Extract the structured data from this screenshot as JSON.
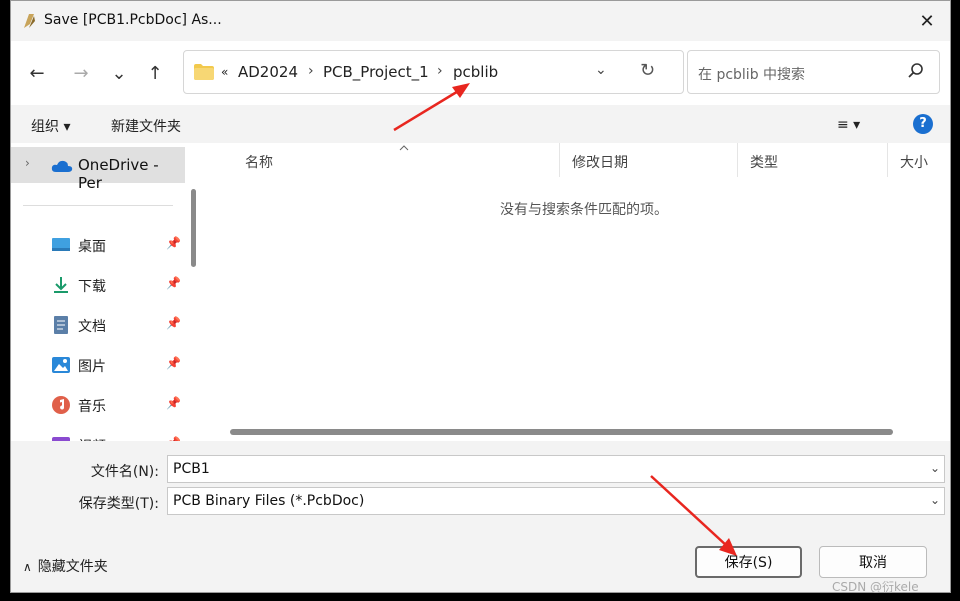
{
  "window": {
    "title": "Save [PCB1.PcbDoc] As..."
  },
  "nav": {
    "back": "←",
    "forward": "→",
    "recent": "⌄",
    "up": "↑",
    "breadcrumb": [
      "«",
      "AD2024",
      "PCB_Project_1",
      "pcblib"
    ],
    "separators": [
      "›",
      "›"
    ],
    "dropdown": "⌄",
    "refresh": "↻",
    "search_placeholder": "在 pcblib 中搜索"
  },
  "toolbar": {
    "organize": "组织 ▾",
    "new_folder": "新建文件夹",
    "view": "≡ ▾",
    "help": "?"
  },
  "sidebar": {
    "onedrive": "OneDrive - Per",
    "items": [
      {
        "label": "桌面",
        "icon": "desktop-icon"
      },
      {
        "label": "下载",
        "icon": "download-icon"
      },
      {
        "label": "文档",
        "icon": "document-icon"
      },
      {
        "label": "图片",
        "icon": "picture-icon"
      },
      {
        "label": "音乐",
        "icon": "music-icon"
      },
      {
        "label": "视频",
        "icon": "video-icon"
      }
    ],
    "pin": "📌"
  },
  "list": {
    "columns": [
      "名称",
      "修改日期",
      "类型",
      "大小"
    ],
    "empty_message": "没有与搜索条件匹配的项。"
  },
  "form": {
    "filename_label": "文件名(N):",
    "filename_value": "PCB1",
    "filetype_label": "保存类型(T):",
    "filetype_value": "PCB Binary Files (*.PcbDoc)"
  },
  "footer": {
    "hide_folders": "隐藏文件夹",
    "save": "保存(S)",
    "cancel": "取消"
  },
  "watermark": "CSDN @衍kele",
  "colors": {
    "accent": "#1a6fd0",
    "annotation_arrow": "#e8261f"
  }
}
